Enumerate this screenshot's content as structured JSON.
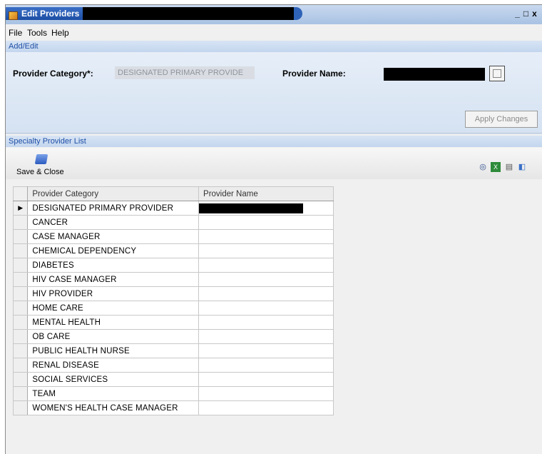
{
  "window": {
    "title": "Edit Providers -",
    "controls": {
      "minimize": "_",
      "maximize": "□",
      "close": "x"
    }
  },
  "menu": {
    "items": [
      "File",
      "Tools",
      "Help"
    ]
  },
  "sections": {
    "add_edit": "Add/Edit",
    "specialty_list": "Specialty Provider List"
  },
  "form": {
    "category_label": "Provider Category*:",
    "category_value": "DESIGNATED PRIMARY PROVIDE",
    "name_label": "Provider Name:",
    "browse_label": "...",
    "apply_label": "Apply Changes"
  },
  "toolbar": {
    "save_close_label": "Save & Close",
    "icons": [
      "binoculars-icon",
      "excel-icon",
      "print-icon",
      "preview-icon"
    ]
  },
  "grid": {
    "headers": [
      "Provider Category",
      "Provider Name"
    ],
    "rows": [
      "DESIGNATED PRIMARY PROVIDER",
      "CANCER",
      "CASE MANAGER",
      "CHEMICAL DEPENDENCY",
      "DIABETES",
      "HIV CASE MANAGER",
      "HIV PROVIDER",
      "HOME CARE",
      "MENTAL HEALTH",
      "OB CARE",
      "PUBLIC HEALTH NURSE",
      "RENAL DISEASE",
      "SOCIAL SERVICES",
      "TEAM",
      "WOMEN'S HEALTH CASE MANAGER"
    ],
    "selected_row_marker": "▶"
  }
}
